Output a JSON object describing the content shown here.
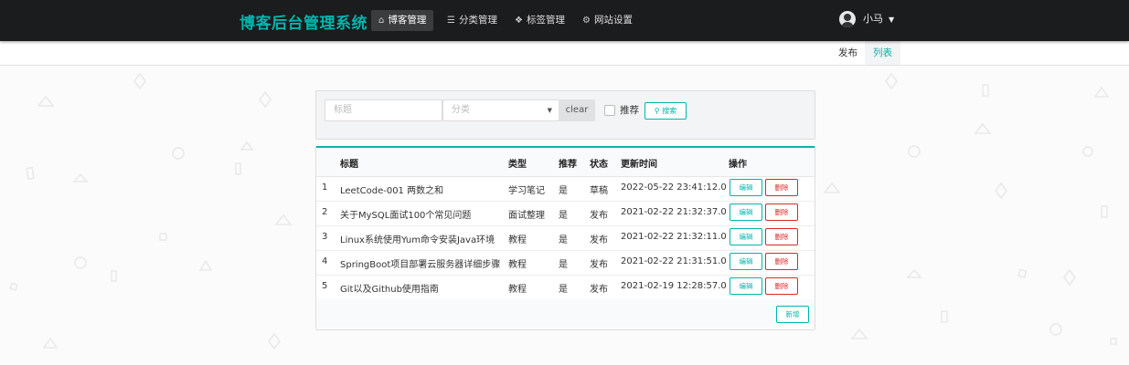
{
  "header": {
    "brand": "博客后台管理系统",
    "nav": [
      {
        "label": "博客管理",
        "icon": "home-icon",
        "active": true
      },
      {
        "label": "分类管理",
        "icon": "list-icon",
        "active": false
      },
      {
        "label": "标签管理",
        "icon": "tags-icon",
        "active": false
      },
      {
        "label": "网站设置",
        "icon": "gear-icon",
        "active": false
      }
    ],
    "user": {
      "name": "小马"
    }
  },
  "subnav": {
    "publish": "发布",
    "list": "列表",
    "active": "list"
  },
  "search": {
    "title_placeholder": "标题",
    "category_placeholder": "分类",
    "clear_label": "clear",
    "recommend_label": "推荐",
    "recommend_checked": false,
    "search_label": "搜索"
  },
  "table": {
    "columns": [
      "",
      "标题",
      "类型",
      "推荐",
      "状态",
      "更新时间",
      "操作"
    ],
    "rows": [
      {
        "index": "1",
        "title": "LeetCode-001 两数之和",
        "type": "学习笔记",
        "recommend": "是",
        "status": "草稿",
        "updated": "2022-05-22 23:41:12.0"
      },
      {
        "index": "2",
        "title": "关于MySQL面试100个常见问题",
        "type": "面试整理",
        "recommend": "是",
        "status": "发布",
        "updated": "2021-02-22 21:32:37.0"
      },
      {
        "index": "3",
        "title": "Linux系统使用Yum命令安装Java环境",
        "type": "教程",
        "recommend": "是",
        "status": "发布",
        "updated": "2021-02-22 21:32:11.0"
      },
      {
        "index": "4",
        "title": "SpringBoot项目部署云服务器详细步骤",
        "type": "教程",
        "recommend": "是",
        "status": "发布",
        "updated": "2021-02-22 21:31:51.0"
      },
      {
        "index": "5",
        "title": "Git以及Github使用指南",
        "type": "教程",
        "recommend": "是",
        "status": "发布",
        "updated": "2021-02-19 12:28:57.0"
      }
    ],
    "edit_label": "编辑",
    "delete_label": "删除",
    "add_label": "新增"
  },
  "colors": {
    "accent": "#00b5ad",
    "danger": "#db2828",
    "topbar": "#1b1c1d"
  }
}
